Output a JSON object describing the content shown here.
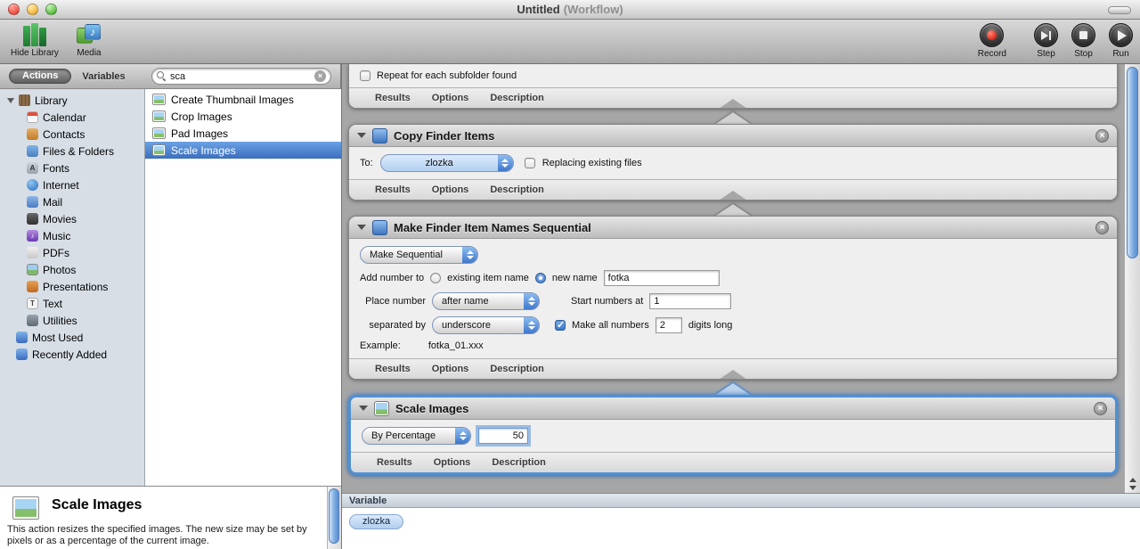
{
  "window": {
    "title_main": "Untitled",
    "title_suffix": "(Workflow)"
  },
  "toolbar": {
    "hide_library": "Hide Library",
    "media": "Media",
    "record": "Record",
    "step": "Step",
    "stop": "Stop",
    "run": "Run"
  },
  "tabs": {
    "actions": "Actions",
    "variables": "Variables"
  },
  "search": {
    "value": "sca"
  },
  "icons": {
    "clear": "×",
    "close": "×",
    "music_note": "♪",
    "fonts_glyph": "A",
    "text_glyph": "T",
    "pdf_glyph": "PDF"
  },
  "library": {
    "root": "Library",
    "items": [
      "Calendar",
      "Contacts",
      "Files & Folders",
      "Fonts",
      "Internet",
      "Mail",
      "Movies",
      "Music",
      "PDFs",
      "Photos",
      "Presentations",
      "Text",
      "Utilities"
    ],
    "footer_items": [
      "Most Used",
      "Recently Added"
    ]
  },
  "results": {
    "items": [
      "Create Thumbnail Images",
      "Crop Images",
      "Pad Images",
      "Scale Images"
    ]
  },
  "workflow": {
    "partial": {
      "checkbox": "Repeat for each subfolder found",
      "footer": [
        "Results",
        "Options",
        "Description"
      ]
    },
    "copy_finder_items": {
      "title": "Copy Finder Items",
      "to_label": "To:",
      "to_value": "zlozka",
      "replacing": "Replacing existing files",
      "footer": [
        "Results",
        "Options",
        "Description"
      ]
    },
    "sequential": {
      "title": "Make Finder Item Names Sequential",
      "make_popup": "Make Sequential",
      "add_number_label": "Add number to",
      "radio_existing": "existing item name",
      "radio_new": "new name",
      "new_name_value": "fotka",
      "place_label": "Place number",
      "place_popup": "after name",
      "start_label": "Start numbers at",
      "start_value": "1",
      "separated_label": "separated by",
      "separated_popup": "underscore",
      "make_all_label": "Make all numbers",
      "digits_value": "2",
      "digits_label": "digits long",
      "example_label": "Example:",
      "example_value": "fotka_01.xxx",
      "footer": [
        "Results",
        "Options",
        "Description"
      ]
    },
    "scale_images": {
      "title": "Scale Images",
      "popup": "By Percentage",
      "value": "50",
      "footer": [
        "Results",
        "Options",
        "Description"
      ]
    }
  },
  "variable_panel": {
    "title": "Variable",
    "items": [
      "zlozka"
    ]
  },
  "description_panel": {
    "title": "Scale Images",
    "text": "This action resizes the specified images. The new size may be set by pixels or as a percentage of the current image."
  }
}
